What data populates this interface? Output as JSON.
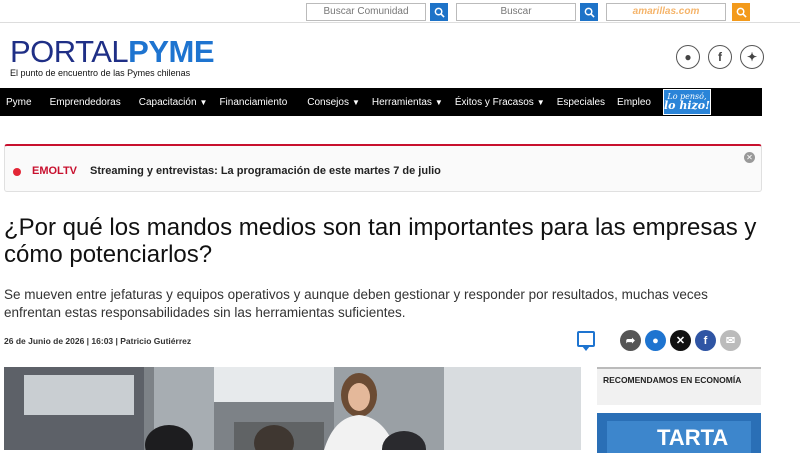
{
  "search": {
    "community_placeholder": "Buscar Comunidad",
    "main_placeholder": "Buscar",
    "amarillas_placeholder": "amarillas.com"
  },
  "header": {
    "logo_thin": "PORTAL",
    "logo_bold": "PYME",
    "tagline": "El punto de encuentro de las Pymes chilenas",
    "social": [
      "community-icon",
      "facebook-icon",
      "twitter-icon"
    ]
  },
  "nav": {
    "items": [
      {
        "label": "Pyme",
        "dropdown": false
      },
      {
        "label": "Emprendedoras",
        "dropdown": false
      },
      {
        "label": "Capacitación",
        "dropdown": true
      },
      {
        "label": "Financiamiento",
        "dropdown": false
      },
      {
        "label": "Consejos",
        "dropdown": true
      },
      {
        "label": "Herramientas",
        "dropdown": true
      },
      {
        "label": "Éxitos y Fracasos",
        "dropdown": true
      },
      {
        "label": "Especiales",
        "dropdown": false
      },
      {
        "label": "Empleo",
        "dropdown": false
      }
    ],
    "badge_top": "Lo pensó,",
    "badge_bottom": "lo hizo!"
  },
  "alert": {
    "tag": "EMOLTV",
    "text": "Streaming y entrevistas: La programación de este martes 7 de julio"
  },
  "article": {
    "headline": "¿Por qué los mandos medios son tan importantes para las empresas y cómo potenciarlos?",
    "lead": "Se mueven entre jefaturas y equipos operativos y aunque deben gestionar y responder por resultados, muchas veces enfrentan estas responsabilidades sin las herramientas suficientes.",
    "byline": "26 de Junio de 2026 | 16:03 | Patricio Gutiérrez"
  },
  "share": [
    {
      "icon": "pin-icon",
      "color": "#555555",
      "glyph": "➶"
    },
    {
      "icon": "community-share-icon",
      "color": "#1e74d0",
      "glyph": "●"
    },
    {
      "icon": "x-icon",
      "color": "#111111",
      "glyph": "✕"
    },
    {
      "icon": "facebook-icon",
      "color": "#2f55a4",
      "glyph": "f"
    },
    {
      "icon": "email-icon",
      "color": "#bbbbbb",
      "glyph": "✉"
    }
  ],
  "sidebar": {
    "heading": "RECOMENDAMOS EN ECONOMÍA",
    "image_text": "TARTA"
  },
  "colors": {
    "accent_blue": "#1e74d0",
    "alert_red": "#c8102e",
    "nav_bg": "#000000",
    "amarillas_orange": "#f39a1b"
  }
}
